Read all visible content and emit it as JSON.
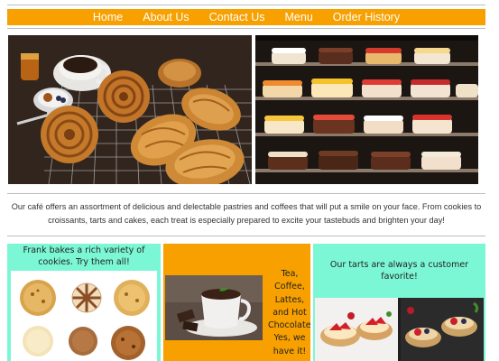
{
  "nav": {
    "items": [
      "Home",
      "About Us",
      "Contact Us",
      "Menu",
      "Order History"
    ]
  },
  "hero": {
    "left_image": "pastries-and-coffee-photo",
    "right_image": "cake-display-case-photo"
  },
  "intro": {
    "text": "Our café offers an assortment of delicious and delectable pastries and coffees that will put a smile on your face. From cookies to croissants, tarts and cakes, each treat is especially prepared to excite your tastebuds and brighten your day!"
  },
  "panels": {
    "cookies": {
      "caption": "Frank bakes a rich variety of cookies. Try them all!",
      "image": "cookies-photo"
    },
    "drinks": {
      "caption": "Tea, Coffee, Lattes, and Hot Chocolate. Yes, we have it!",
      "image": "hot-chocolate-photo"
    },
    "tarts": {
      "caption": "Our tarts are always a customer favorite!",
      "image": "strawberry-tarts-photo"
    }
  },
  "colors": {
    "accent_orange": "#f7a000",
    "panel_mint": "#7cf7d5",
    "nav_text": "#ffffff"
  }
}
